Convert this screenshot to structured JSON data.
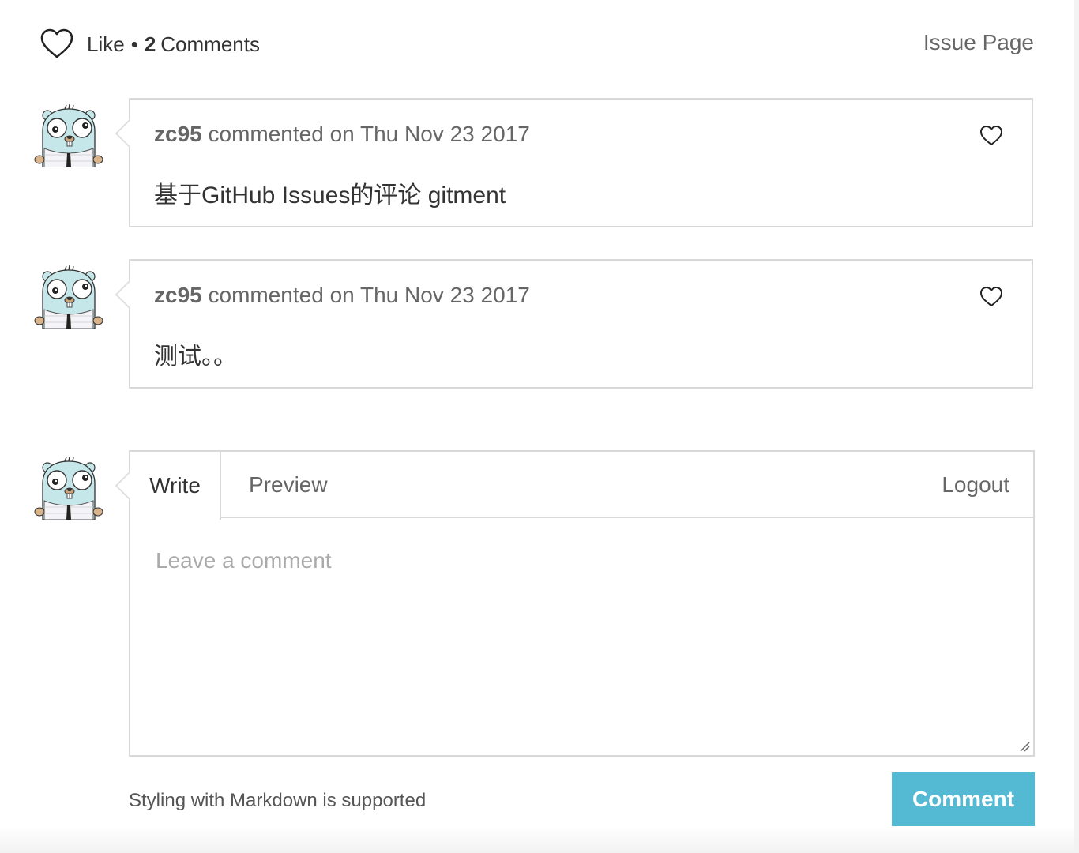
{
  "header": {
    "like_label": "Like",
    "separator": "•",
    "comment_count": "2",
    "comments_label": "Comments",
    "issue_page_label": "Issue Page"
  },
  "comments": [
    {
      "author": "zc95",
      "meta": "commented on Thu Nov 23 2017",
      "body": "基于GitHub Issues的评论 gitment"
    },
    {
      "author": "zc95",
      "meta": "commented on Thu Nov 23 2017",
      "body": "测试。。"
    }
  ],
  "editor": {
    "tab_write": "Write",
    "tab_preview": "Preview",
    "logout": "Logout",
    "placeholder": "Leave a comment",
    "value": ""
  },
  "footer": {
    "markdown_note": "Styling with Markdown is supported",
    "submit_label": "Comment"
  },
  "colors": {
    "accent": "#54b9d3",
    "border": "#d8d8d8",
    "muted_text": "#666666",
    "avatar_body": "#c6e7e9"
  }
}
